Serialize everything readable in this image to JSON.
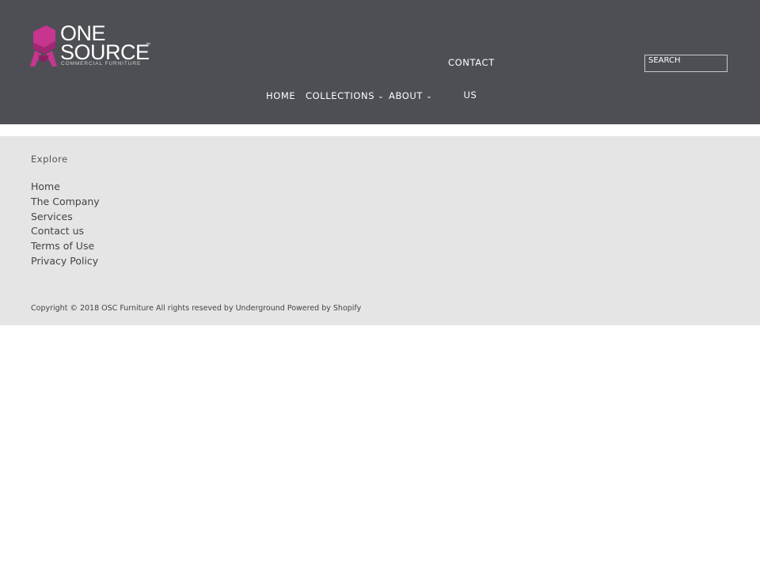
{
  "header": {
    "logo": {
      "line1": "ONE",
      "line2": "SOURCE",
      "tm": "™",
      "tagline": "COMMERCIAL FURNITURE",
      "accent_color": "#c6358e",
      "icon": "chair-logo-icon"
    },
    "nav": {
      "home": "HOME",
      "collections": "COLLECTIONS",
      "about": "ABOUT",
      "contact_line1": "CONTACT",
      "contact_line2": "US",
      "dropdown_icon": "chevron-down-icon"
    },
    "search": {
      "placeholder": "SEARCH"
    },
    "background_color": "#4e4f54"
  },
  "footer": {
    "title": "Explore",
    "links": [
      "Home",
      "The Company",
      "Services",
      "Contact us",
      "Terms of Use",
      "Privacy Policy"
    ],
    "copyright": "Copyright © 2018 OSC Furniture All rights reseved by Underground Powered by Shopify",
    "background_color": "#e5e5e5"
  }
}
